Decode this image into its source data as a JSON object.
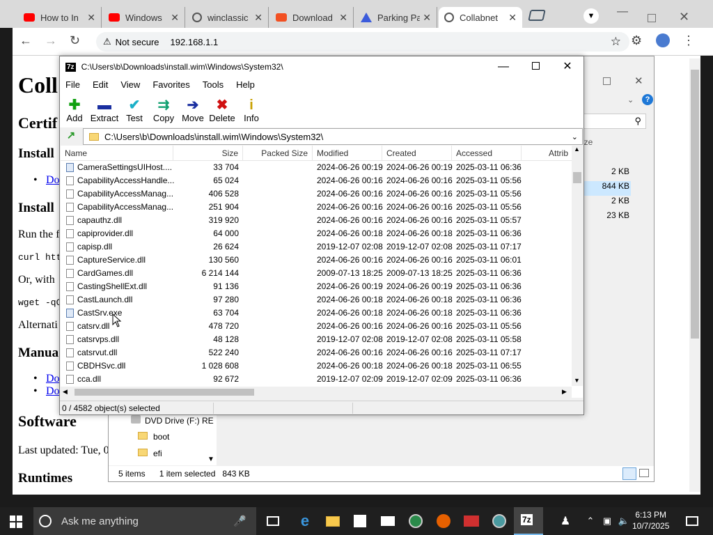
{
  "browser": {
    "tabs": [
      {
        "title": "How to In",
        "icon": "youtube-icon",
        "color": "#ff0000"
      },
      {
        "title": "Windows",
        "icon": "youtube-icon",
        "color": "#ff0000"
      },
      {
        "title": "winclassic",
        "icon": "globe-icon",
        "color": "#555555"
      },
      {
        "title": "Download",
        "icon": "windows-logo-icon",
        "color": "#f25022"
      },
      {
        "title": "Parking Pa",
        "icon": "triangle-logo-icon",
        "color": "#3b5bdb"
      },
      {
        "title": "Collabnet",
        "icon": "globe-icon",
        "color": "#555555"
      }
    ],
    "security": "Not secure",
    "url": "192.168.1.1"
  },
  "webpage": {
    "title": "Coll",
    "cert": "Certif",
    "install1": "Install",
    "install2": "Install",
    "link1": "Do",
    "run": "Run the f",
    "curl": "curl htt",
    "or": "Or, with",
    "wget": "wget -qO",
    "alt": "Alternati",
    "manual": "Manua",
    "link2": "Do",
    "link3": "Do",
    "software": "Software",
    "updated": "Last updated: Tue, 0",
    "runtimes": "Runtimes"
  },
  "explorer": {
    "sizes": [
      "2 KB",
      "844 KB",
      "2 KB",
      "23 KB"
    ],
    "size_header": "ize",
    "tree": [
      {
        "label": "DVD Drive (F:) RE"
      },
      {
        "label": "boot"
      },
      {
        "label": "efi"
      }
    ],
    "status": {
      "items": "5 items",
      "selected": "1 item selected",
      "size": "843 KB"
    }
  },
  "sevenzip": {
    "title": "C:\\Users\\b\\Downloads\\install.wim\\Windows\\System32\\",
    "menu": [
      "File",
      "Edit",
      "View",
      "Favorites",
      "Tools",
      "Help"
    ],
    "toolbar": [
      {
        "label": "Add",
        "icon": "plus-icon",
        "color": "#10a010"
      },
      {
        "label": "Extract",
        "icon": "minus-icon",
        "color": "#1a2fa0"
      },
      {
        "label": "Test",
        "icon": "check-icon",
        "color": "#1bb0c8"
      },
      {
        "label": "Copy",
        "icon": "double-arrow-icon",
        "color": "#10a070"
      },
      {
        "label": "Move",
        "icon": "arrow-right-icon",
        "color": "#1a2fa0"
      },
      {
        "label": "Delete",
        "icon": "x-icon",
        "color": "#d01010"
      },
      {
        "label": "Info",
        "icon": "info-icon",
        "color": "#c8a000"
      }
    ],
    "path": "C:\\Users\\b\\Downloads\\install.wim\\Windows\\System32\\",
    "columns": [
      "Name",
      "Size",
      "Packed Size",
      "Modified",
      "Created",
      "Accessed",
      "Attrib"
    ],
    "rows": [
      {
        "name": "CameraSettingsUIHost....",
        "size": "33 704",
        "packed": "",
        "modified": "2024-06-26 00:19",
        "created": "2024-06-26 00:19",
        "accessed": "2025-03-11 06:36",
        "type": "exe"
      },
      {
        "name": "CapabilityAccessHandle...",
        "size": "65 024",
        "packed": "",
        "modified": "2024-06-26 00:16",
        "created": "2024-06-26 00:16",
        "accessed": "2025-03-11 05:56",
        "type": "dll"
      },
      {
        "name": "CapabilityAccessManag...",
        "size": "406 528",
        "packed": "",
        "modified": "2024-06-26 00:16",
        "created": "2024-06-26 00:16",
        "accessed": "2025-03-11 05:56",
        "type": "dll"
      },
      {
        "name": "CapabilityAccessManag...",
        "size": "251 904",
        "packed": "",
        "modified": "2024-06-26 00:16",
        "created": "2024-06-26 00:16",
        "accessed": "2025-03-11 05:56",
        "type": "dll"
      },
      {
        "name": "capauthz.dll",
        "size": "319 920",
        "packed": "",
        "modified": "2024-06-26 00:16",
        "created": "2024-06-26 00:16",
        "accessed": "2025-03-11 05:57",
        "type": "dll"
      },
      {
        "name": "capiprovider.dll",
        "size": "64 000",
        "packed": "",
        "modified": "2024-06-26 00:18",
        "created": "2024-06-26 00:18",
        "accessed": "2025-03-11 06:36",
        "type": "dll"
      },
      {
        "name": "capisp.dll",
        "size": "26 624",
        "packed": "",
        "modified": "2019-12-07 02:08",
        "created": "2019-12-07 02:08",
        "accessed": "2025-03-11 07:17",
        "type": "dll"
      },
      {
        "name": "CaptureService.dll",
        "size": "130 560",
        "packed": "",
        "modified": "2024-06-26 00:16",
        "created": "2024-06-26 00:16",
        "accessed": "2025-03-11 06:01",
        "type": "dll"
      },
      {
        "name": "CardGames.dll",
        "size": "6 214 144",
        "packed": "",
        "modified": "2009-07-13 18:25",
        "created": "2009-07-13 18:25",
        "accessed": "2025-03-11 06:36",
        "type": "dll"
      },
      {
        "name": "CastingShellExt.dll",
        "size": "91 136",
        "packed": "",
        "modified": "2024-06-26 00:19",
        "created": "2024-06-26 00:19",
        "accessed": "2025-03-11 06:36",
        "type": "dll"
      },
      {
        "name": "CastLaunch.dll",
        "size": "97 280",
        "packed": "",
        "modified": "2024-06-26 00:18",
        "created": "2024-06-26 00:18",
        "accessed": "2025-03-11 06:36",
        "type": "dll"
      },
      {
        "name": "CastSrv.exe",
        "size": "63 704",
        "packed": "",
        "modified": "2024-06-26 00:18",
        "created": "2024-06-26 00:18",
        "accessed": "2025-03-11 06:36",
        "type": "exe"
      },
      {
        "name": "catsrv.dll",
        "size": "478 720",
        "packed": "",
        "modified": "2024-06-26 00:16",
        "created": "2024-06-26 00:16",
        "accessed": "2025-03-11 05:56",
        "type": "dll"
      },
      {
        "name": "catsrvps.dll",
        "size": "48 128",
        "packed": "",
        "modified": "2019-12-07 02:08",
        "created": "2019-12-07 02:08",
        "accessed": "2025-03-11 05:58",
        "type": "dll"
      },
      {
        "name": "catsrvut.dll",
        "size": "522 240",
        "packed": "",
        "modified": "2024-06-26 00:16",
        "created": "2024-06-26 00:16",
        "accessed": "2025-03-11 07:17",
        "type": "dll"
      },
      {
        "name": "CBDHSvc.dll",
        "size": "1 028 608",
        "packed": "",
        "modified": "2024-06-26 00:18",
        "created": "2024-06-26 00:18",
        "accessed": "2025-03-11 06:55",
        "type": "dll"
      },
      {
        "name": "cca.dll",
        "size": "92 672",
        "packed": "",
        "modified": "2019-12-07 02:09",
        "created": "2019-12-07 02:09",
        "accessed": "2025-03-11 06:36",
        "type": "dll"
      }
    ],
    "status": "0 / 4582 object(s) selected"
  },
  "taskbar": {
    "search_placeholder": "Ask me anything",
    "time": "6:13 PM",
    "date": "10/7/2025"
  }
}
